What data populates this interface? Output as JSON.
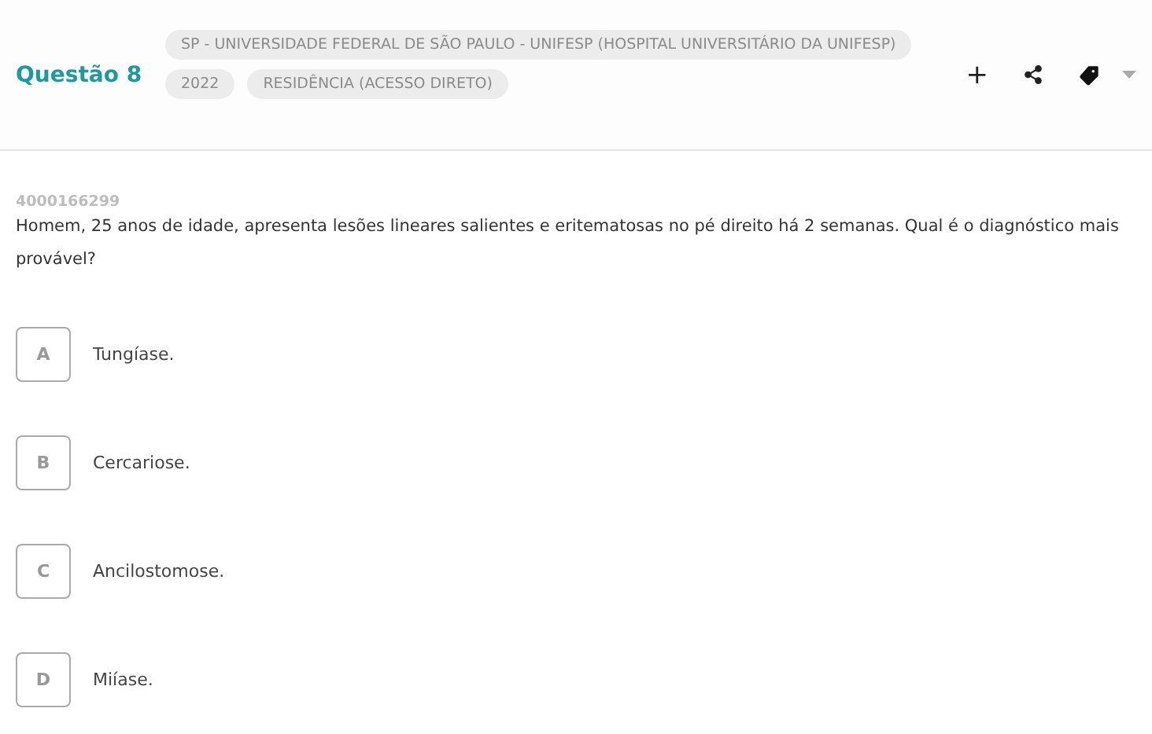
{
  "header": {
    "title": "Questão 8",
    "tags": [
      [
        "SP - UNIVERSIDADE FEDERAL DE SÃO PAULO - UNIFESP (HOSPITAL UNIVERSITÁRIO DA UNIFESP)"
      ],
      [
        "2022",
        "RESIDÊNCIA (ACESSO DIRETO)"
      ]
    ],
    "add": "+"
  },
  "question": {
    "id": "4000166299",
    "text": "Homem, 25 anos de idade, apresenta lesões lineares salientes e eritematosas no pé direito há 2 semanas. Qual é o diagnóstico mais provável?"
  },
  "options": [
    {
      "letter": "A",
      "text": "Tungíase."
    },
    {
      "letter": "B",
      "text": "Cercariose."
    },
    {
      "letter": "C",
      "text": "Ancilostomose."
    },
    {
      "letter": "D",
      "text": "Miíase."
    }
  ]
}
